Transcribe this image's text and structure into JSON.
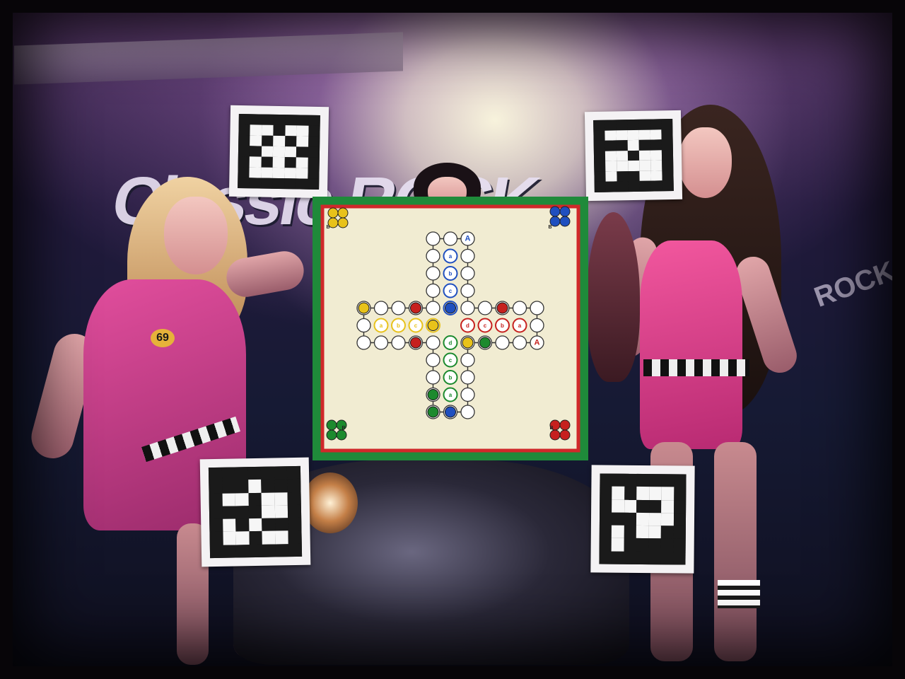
{
  "scene": {
    "background_logo": "Classic ROCK",
    "badge_number": "69"
  },
  "markers": [
    {
      "name": "top-left",
      "pattern": [
        "0000000",
        "0110110",
        "0101010",
        "0011100",
        "0101010",
        "0111110",
        "0000000"
      ]
    },
    {
      "name": "top-right",
      "pattern": [
        "0000000",
        "0111110",
        "0001000",
        "0110110",
        "0111110",
        "0100110",
        "0000000"
      ]
    },
    {
      "name": "bottom-left",
      "pattern": [
        "0000000",
        "0001000",
        "0110110",
        "0000110",
        "0101000",
        "0110110",
        "0000000"
      ]
    },
    {
      "name": "bottom-right",
      "pattern": [
        "0000000",
        "0101110",
        "0110010",
        "0001110",
        "0101100",
        "0100000",
        "0000000"
      ]
    }
  ],
  "board": {
    "home_labels": {
      "yellow": "B",
      "blue": "B",
      "green": "B",
      "red": "B"
    },
    "colors": {
      "yellow": "#e8c21a",
      "blue": "#1f4fbf",
      "green": "#1c8a2e",
      "red": "#c6201e",
      "board_bg": "#f1ecd2",
      "border_green": "#1f8a3a",
      "border_red": "#d0282a"
    },
    "finish_letters": {
      "yellow": [
        "a",
        "b",
        "c",
        "d"
      ],
      "blue": [
        "a",
        "b",
        "c",
        "d"
      ],
      "green": [
        "a",
        "b",
        "c",
        "d"
      ],
      "red": [
        "a",
        "b",
        "c",
        "d"
      ]
    },
    "start_letters": {
      "blue": "A",
      "red": "A"
    }
  }
}
